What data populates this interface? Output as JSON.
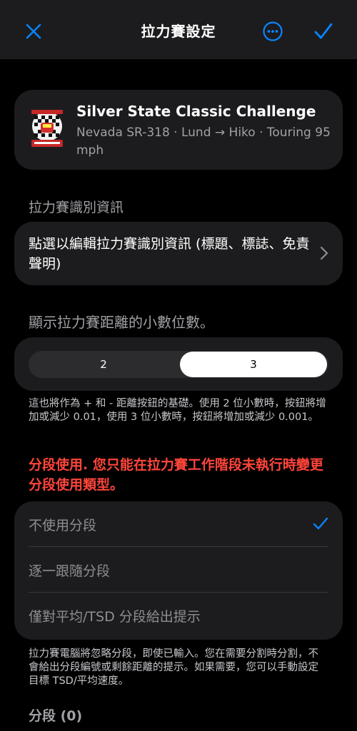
{
  "nav": {
    "title": "拉力賽設定",
    "accent": "#0a84ff"
  },
  "event": {
    "title": "Silver State Classic Challenge",
    "subtitle": "Nevada SR-318 · Lund → Hiko · Touring 95 mph",
    "logo_icon": "silver-state-classic-challenge-logo"
  },
  "identity": {
    "section_label": "拉力賽識別資訊",
    "edit_text": "點選以編輯拉力賽識別資訊 (標題、標誌、免責聲明)"
  },
  "decimals": {
    "section_label": "顯示拉力賽距離的小數位數。",
    "options": [
      "2",
      "3"
    ],
    "selected": "3",
    "footnote": "這也將作為 + 和 - 距離按鈕的基礎。使用 2 位小數時，按鈕將增加或減少 0.01，使用 3 位小數時，按鈕將增加或減少 0.001。"
  },
  "segments": {
    "warning": "分段使用. 您只能在拉力賽工作階段未執行時變更分段使用類型。",
    "warning_color": "#ff453a",
    "options": [
      "不使用分段",
      "逐一跟隨分段",
      "僅對平均/TSD 分段給出提示"
    ],
    "selected_index": 0,
    "footnote": "拉力賽電腦將忽略分段，即使已輸入。您在需要分割時分割，不會給出分段編號或剩餘距離的提示。如果需要，您可以手動設定目標 TSD/平均速度。",
    "count_label": "分段 (0)"
  }
}
